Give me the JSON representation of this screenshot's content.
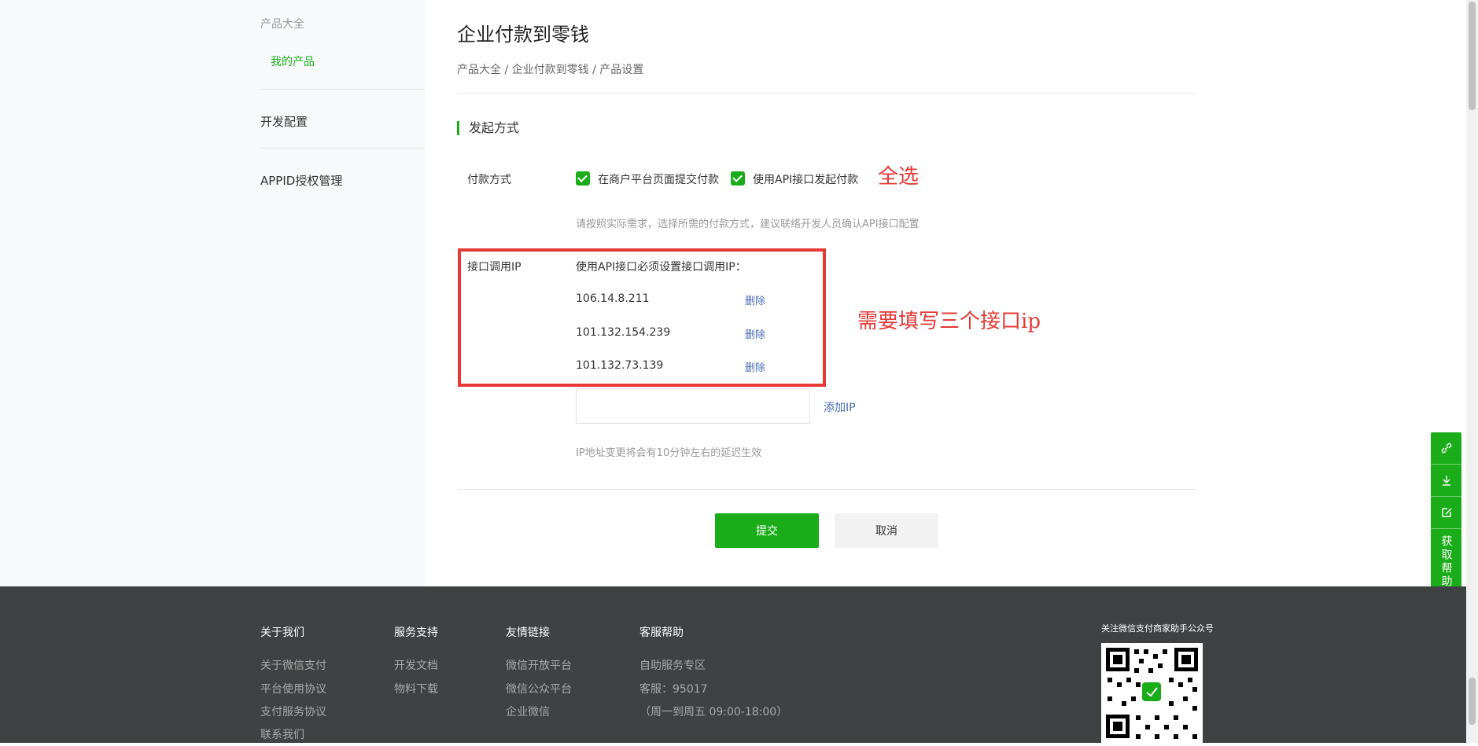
{
  "sidebar": {
    "section_header": "产品大全",
    "sub_item": "我的产品",
    "items": [
      "开发配置",
      "APPID授权管理"
    ]
  },
  "page": {
    "title": "企业付款到零钱",
    "breadcrumb": "产品大全 / 企业付款到零钱 / 产品设置",
    "section_title": "发起方式"
  },
  "payment_method": {
    "label": "付款方式",
    "options": [
      {
        "label": "在商户平台页面提交付款",
        "checked": true
      },
      {
        "label": "使用API接口发起付款",
        "checked": true
      }
    ],
    "hint": "请按照实际需求，选择所需的付款方式，建议联络开发人员确认API接口配置"
  },
  "annotations": {
    "select_all": "全选",
    "fill_ips": "需要填写三个接口ip"
  },
  "ip_config": {
    "label": "接口调用IP",
    "title": "使用API接口必须设置接口调用IP：",
    "ips": [
      "106.14.8.211",
      "101.132.154.239",
      "101.132.73.139"
    ],
    "delete_label": "删除",
    "input_value": "",
    "add_label": "添加IP",
    "hint": "IP地址变更将会有10分钟左右的延迟生效"
  },
  "actions": {
    "submit": "提交",
    "cancel": "取消"
  },
  "float_tools": {
    "help_label": "获取帮助",
    "icons": [
      "link-icon",
      "download-icon",
      "edit-icon"
    ]
  },
  "footer": {
    "columns": [
      {
        "title": "关于我们",
        "links": [
          "关于微信支付",
          "平台使用协议",
          "支付服务协议",
          "联系我们"
        ]
      },
      {
        "title": "服务支持",
        "links": [
          "开发文档",
          "物料下载"
        ]
      },
      {
        "title": "友情链接",
        "links": [
          "微信开放平台",
          "微信公众平台",
          "企业微信"
        ]
      },
      {
        "title": "客服帮助",
        "links": [
          "自助服务专区",
          "客服：95017",
          "（周一到周五 09:00-18:00）"
        ]
      }
    ],
    "qr_title": "关注微信支付商家助手公众号"
  },
  "colors": {
    "accent": "#1aad19",
    "annotation": "#e53935",
    "link": "#4a6ab5",
    "footer_bg": "#3f4142"
  }
}
